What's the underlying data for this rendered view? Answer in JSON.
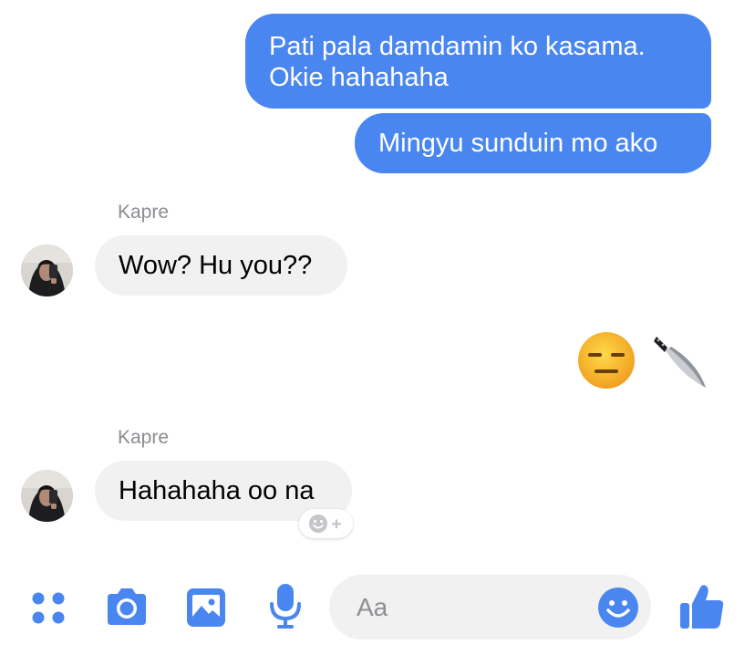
{
  "messages": [
    {
      "direction": "outgoing",
      "lines": [
        "Pati pala damdamin ko kasama.",
        "Okie hahahaha"
      ]
    },
    {
      "direction": "outgoing",
      "text": "Mingyu sunduin mo ako"
    },
    {
      "direction": "incoming",
      "sender": "Kapre",
      "text": "Wow? Hu you??"
    },
    {
      "direction": "outgoing",
      "emoji": [
        "expressionless-face",
        "kitchen-knife"
      ]
    },
    {
      "direction": "incoming",
      "sender": "Kapre",
      "text": "Hahahaha oo na"
    }
  ],
  "composer": {
    "placeholder": "Aa"
  },
  "toolbar": {
    "icons": [
      "menu-dots-icon",
      "camera-icon",
      "photo-icon",
      "microphone-icon",
      "emoji-icon",
      "thumbs-up-icon"
    ]
  },
  "colors": {
    "outgoing_bubble": "#4a86f0",
    "incoming_bubble": "#f1f1f1",
    "accent": "#4a86f0",
    "sender_name": "#8a8d91"
  }
}
